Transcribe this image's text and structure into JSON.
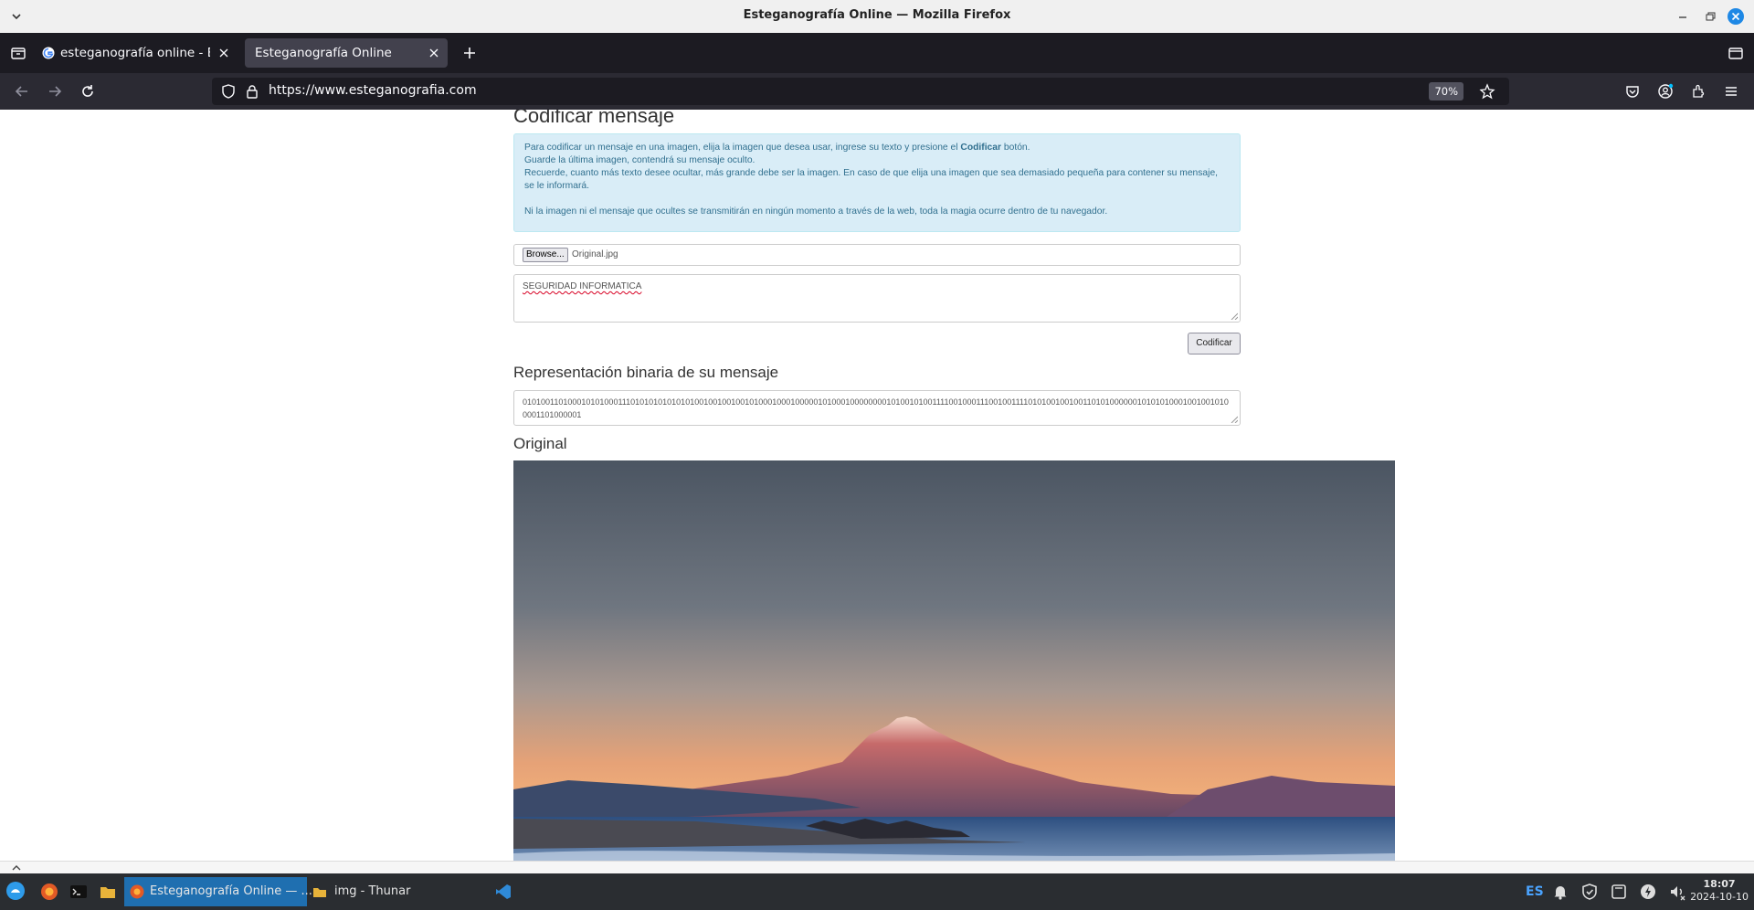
{
  "window": {
    "title": "Esteganografía Online — Mozilla Firefox"
  },
  "tabs": [
    {
      "label": "esteganografía online - Bus",
      "active": false
    },
    {
      "label": "Esteganografía Online",
      "active": true
    }
  ],
  "navbar": {
    "url": "https://www.esteganografia.com",
    "zoom": "70%"
  },
  "page": {
    "heading": "Codificar mensaje",
    "info": {
      "line1_pre": "Para codificar un mensaje en una imagen, elija la imagen que desea usar, ingrese su texto y presione el ",
      "line1_bold": "Codificar",
      "line1_post": " botón.",
      "line2": "Guarde la última imagen, contendrá su mensaje oculto.",
      "line3": "Recuerde, cuanto más texto desee ocultar, más grande debe ser la imagen. En caso de que elija una imagen que sea demasiado pequeña para contener su mensaje, se le informará.",
      "line4": "Ni la imagen ni el mensaje que ocultes se transmitirán en ningún momento a través de la web, toda la magia ocurre dentro de tu navegador."
    },
    "file_button": "Browse...",
    "file_name": "Original.jpg",
    "message": "SEGURIDAD INFORMATICA",
    "encode_button": "Codificar",
    "binary_heading": "Representación binaria de su mensaje",
    "binary_text": "0101001101000101010001110101010101010100100100100101000100010000010100010000000010100101001111001000111001001111010100100100110101000000101010100010010010100001101000001",
    "original_heading": "Original"
  },
  "taskbar": {
    "tasks": [
      {
        "label": "Esteganografía Online — ...",
        "active": true
      },
      {
        "label": "img - Thunar",
        "active": false
      }
    ],
    "keyboard_layout": "ES",
    "time": "18:07",
    "date": "2024-10-10"
  },
  "colors": {
    "info_bg": "#d9edf7",
    "info_text": "#31708f",
    "tab_bar": "#1c1b22",
    "active_task": "#1f6fb0"
  }
}
